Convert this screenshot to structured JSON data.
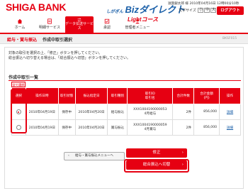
{
  "header": {
    "bank_name": "SHIGA BANK",
    "service_prefix": "しがぎん",
    "service_name": "Bizダイレクト",
    "service_plan": "Lightコース",
    "user_info": "滋賀銀太郎 様 2010年04月16日 12時00分10秒",
    "font_size_label": "文字サイズ",
    "font_size_options": [
      "小",
      "中",
      "大"
    ],
    "logout_label": "ログアウト"
  },
  "nav": {
    "tabs": [
      {
        "label": "ホーム",
        "icon": "home-icon"
      },
      {
        "label": "明細サービス",
        "icon": "document-icon"
      },
      {
        "label": "データ伝送サービス",
        "icon": "transfer-icon"
      },
      {
        "label": "承認",
        "icon": "approve-icon"
      },
      {
        "label": "管理者メニュー",
        "icon": "admin-icon"
      }
    ]
  },
  "breadcrumb": {
    "section": "給与・賞与振込",
    "page": "作成中取引選択",
    "screen_id": "BKSF015"
  },
  "instructions": [
    "対象の取引を選択の上、「修正」ボタンを押してください。",
    "総合振込へ切り替える場合は、「総合振込へ切替」ボタンを押してください。"
  ],
  "section_title": "作成中取引一覧",
  "select_all_label": "全て選択",
  "table": {
    "headers": [
      "選択",
      "操作日時",
      "取引状態",
      "振込指定日",
      "取引種別",
      "取引ID\n取引名",
      "合計件数",
      "合計金額\n(円)",
      "操作"
    ],
    "rows": [
      {
        "datetime": "2010年04月19日",
        "status": "保存中",
        "date": "2010年04月20日",
        "type": "給与振込",
        "id": "XXX1004190000053",
        "name": "4月給与",
        "count": "2件",
        "amount": "856,000",
        "action": "詳細",
        "selected": true
      },
      {
        "datetime": "2010年04月19日",
        "status": "保存中",
        "date": "2010年04月20日",
        "type": "賞与振込",
        "id": "XXX1004190000059",
        "name": "4月賞与",
        "count": "2件",
        "amount": "856,000",
        "action": "詳細",
        "selected": false
      }
    ]
  },
  "buttons": {
    "edit": "修正",
    "back": "給与・賞与振込メニューへ",
    "switch": "総合振込へ切替"
  }
}
